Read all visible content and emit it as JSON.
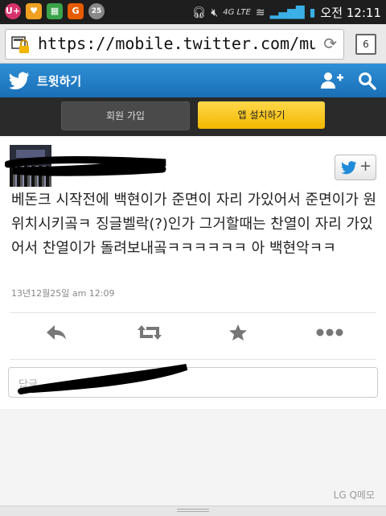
{
  "status_bar": {
    "time": "오전 12:11",
    "network": "4G LTE",
    "apps": [
      {
        "label": "U+",
        "color": "#d6336c",
        "icon": "uplus-icon"
      },
      {
        "label": "♥",
        "color": "#f0a020",
        "icon": "notification-icon"
      },
      {
        "label": "▦",
        "color": "#3aa34a",
        "icon": "grid-app-icon"
      },
      {
        "label": "G",
        "color": "#e65c00",
        "icon": "g-app-icon"
      },
      {
        "label": "25",
        "color": "#888888",
        "icon": "calendar-icon"
      }
    ]
  },
  "browser": {
    "url": "https://mobile.twitter.com/mungm",
    "tab_count": "6"
  },
  "twitter_header": {
    "title": "트윗하기",
    "accent": "#1f79c2"
  },
  "promo": {
    "join_label": "회원 가입",
    "install_label": "앱 설치하기"
  },
  "tweet": {
    "text": "베돈크 시작전에 백현이가 준면이 자리 가있어서 준면이가 원위치시키곸ㅋ 징글벨락(?)인가 그거할때는 찬열이 자리 가있어서 찬열이가 돌려보내곸ㅋㅋㅋㅋㅋㅋ 아 백현악ㅋㅋ",
    "timestamp": "13년12월25일 am 12:09"
  },
  "reply": {
    "placeholder": "답글"
  },
  "footer": {
    "label": "LG Q메모"
  }
}
